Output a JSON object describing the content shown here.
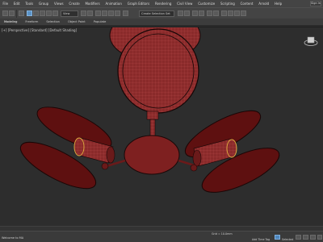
{
  "menu": {
    "items": [
      "File",
      "Edit",
      "Tools",
      "Group",
      "Views",
      "Create",
      "Modifiers",
      "Animation",
      "Graph Editors",
      "Rendering",
      "Civil View",
      "Customize",
      "Scripting",
      "Content",
      "Arnold",
      "Help"
    ],
    "sign_in": "Sign in"
  },
  "toolbar": {
    "selection_set": "Create Selection Set",
    "view_dropdown": "View"
  },
  "ribbon": {
    "tabs": [
      "Modeling",
      "Freeform",
      "Selection",
      "Object Paint",
      "Populate"
    ]
  },
  "viewport": {
    "label": "[+] [Perspective] [Standard] [Default Shading]"
  },
  "status": {
    "left": "Welcome to MA",
    "coords": "Grid = 10.0mm",
    "add_time_tag": "Add Time Tag",
    "selected": "Selected"
  },
  "colors": {
    "model_fill": "#8a2a2a",
    "model_wire": "#c05050",
    "viewport_bg": "#2d2d2d",
    "selection": "#e0b040"
  }
}
